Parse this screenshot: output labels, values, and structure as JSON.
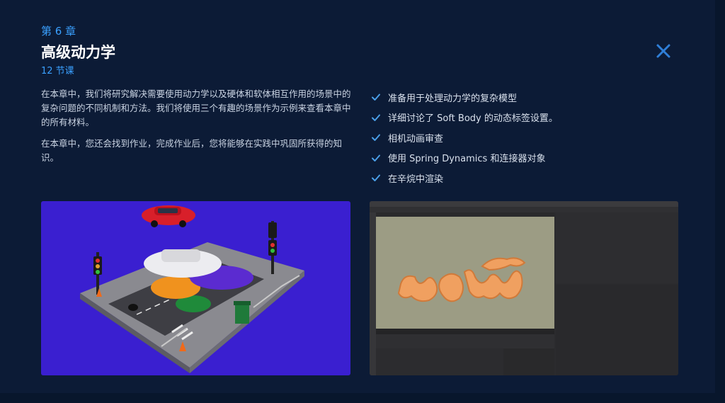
{
  "chapter": {
    "label": "第 6 章"
  },
  "title": "高级动力学",
  "lessons": "12 节课",
  "description": [
    "在本章中，我们将研究解决需要使用动力学以及硬体和软体相互作用的场景中的复杂问题的不同机制和方法。我们将使用三个有趣的场景作为示例来查看本章中的所有材料。",
    "在本章中，您还会找到作业，完成作业后，您将能够在实践中巩固所获得的知识。"
  ],
  "features": [
    "准备用于处理动力学的复杂模型",
    "详细讨论了 Soft Body 的动态标签设置。",
    "相机动画审查",
    "使用 Spring Dynamics 和连接器对象",
    "在辛烷中渲染"
  ],
  "colors": {
    "accent": "#3aa0ff",
    "background": "#0c1b36",
    "left_image_bg": "#3a1fd0",
    "check": "#4a9fe8"
  },
  "icons": {
    "close": "close-icon",
    "check": "check-icon"
  }
}
